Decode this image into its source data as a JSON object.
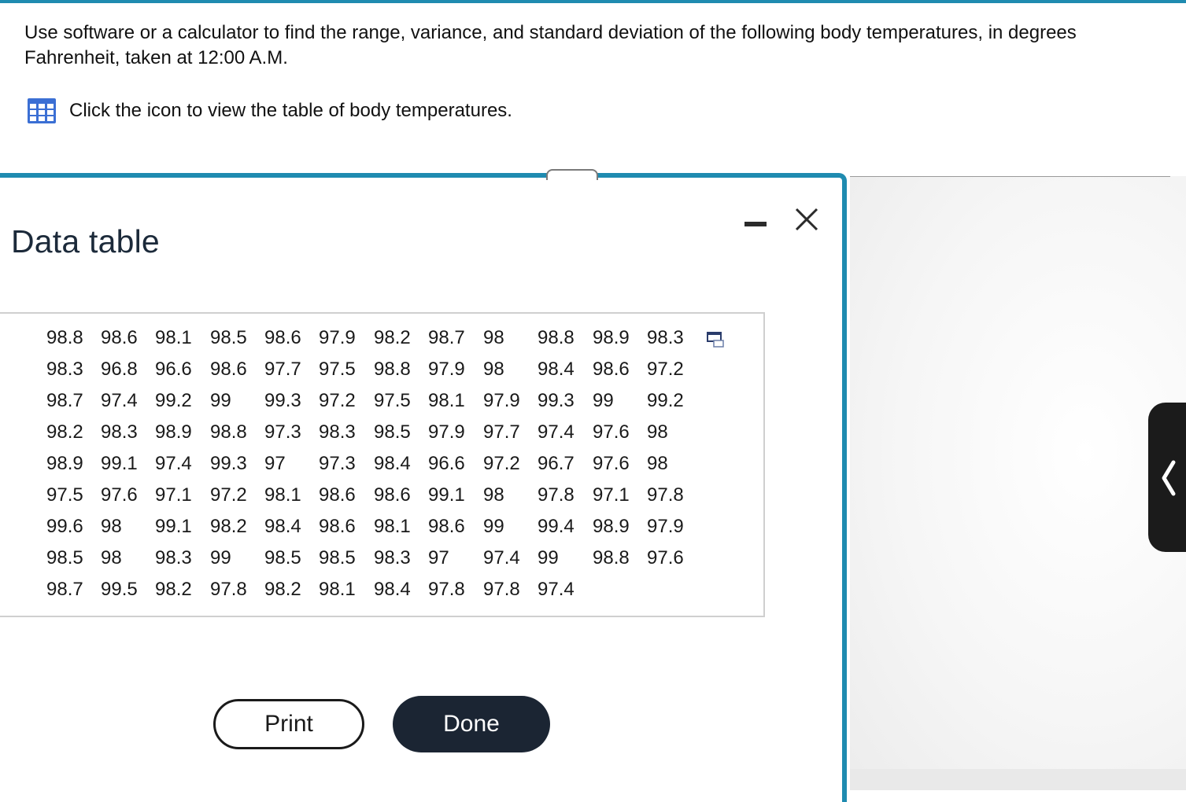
{
  "question": {
    "text": "Use software or a calculator to find the range, variance, and standard deviation of the following body temperatures, in degrees Fahrenheit, taken at 12:00 A.M.",
    "icon_prompt": "Click the icon to view the table of body temperatures."
  },
  "dialog": {
    "title": "Data table",
    "print_label": "Print",
    "done_label": "Done"
  },
  "temperatures": [
    [
      "98.8",
      "98.6",
      "98.1",
      "98.5",
      "98.6",
      "97.9",
      "98.2",
      "98.7",
      "98",
      "98.8",
      "98.9",
      "98.3"
    ],
    [
      "98.3",
      "96.8",
      "96.6",
      "98.6",
      "97.7",
      "97.5",
      "98.8",
      "97.9",
      "98",
      "98.4",
      "98.6",
      "97.2"
    ],
    [
      "98.7",
      "97.4",
      "99.2",
      "99",
      "99.3",
      "97.2",
      "97.5",
      "98.1",
      "97.9",
      "99.3",
      "99",
      "99.2"
    ],
    [
      "98.2",
      "98.3",
      "98.9",
      "98.8",
      "97.3",
      "98.3",
      "98.5",
      "97.9",
      "97.7",
      "97.4",
      "97.6",
      "98"
    ],
    [
      "98.9",
      "99.1",
      "97.4",
      "99.3",
      "97",
      "97.3",
      "98.4",
      "96.6",
      "97.2",
      "96.7",
      "97.6",
      "98"
    ],
    [
      "97.5",
      "97.6",
      "97.1",
      "97.2",
      "98.1",
      "98.6",
      "98.6",
      "99.1",
      "98",
      "97.8",
      "97.1",
      "97.8"
    ],
    [
      "99.6",
      "98",
      "99.1",
      "98.2",
      "98.4",
      "98.6",
      "98.1",
      "98.6",
      "99",
      "99.4",
      "98.9",
      "97.9"
    ],
    [
      "98.5",
      "98",
      "98.3",
      "99",
      "98.5",
      "98.5",
      "98.3",
      "97",
      "97.4",
      "99",
      "98.8",
      "97.6"
    ],
    [
      "98.7",
      "99.5",
      "98.2",
      "97.8",
      "98.2",
      "98.1",
      "98.4",
      "97.8",
      "97.8",
      "97.4"
    ]
  ],
  "icons": {
    "table": "table-grid-icon",
    "copy": "copy-icon",
    "minimize": "minimize-icon",
    "close": "close-icon",
    "drawer": "chevron-left-icon"
  },
  "colors": {
    "accent": "#1f8bb0",
    "done_button": "#1b2533",
    "icon_blue": "#3b6fd4"
  }
}
